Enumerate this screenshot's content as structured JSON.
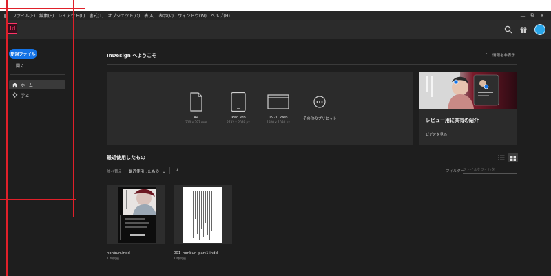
{
  "menubar": {
    "items": [
      "ファイル(F)",
      "編集(E)",
      "レイアウト(L)",
      "書式(T)",
      "オブジェクト(O)",
      "表(A)",
      "表示(V)",
      "ウィンドウ(W)",
      "ヘルプ(H)"
    ]
  },
  "window_controls": [
    "—",
    "⧉",
    "✕"
  ],
  "appbar": {
    "logo": "Id"
  },
  "sidebar": {
    "new_file": "新規ファイル",
    "open": "開く",
    "nav": [
      {
        "label": "ホーム",
        "icon": "home-icon",
        "active": true
      },
      {
        "label": "学ぶ",
        "icon": "lightbulb-icon",
        "active": false
      }
    ]
  },
  "welcome": {
    "title": "InDesign へようこそ",
    "hide_info": "情報を非表示"
  },
  "presets": [
    {
      "name": "A4",
      "size": "210 x 297 mm",
      "icon": "document-icon"
    },
    {
      "name": "iPad Pro",
      "size": "2732 x 2048 px",
      "icon": "tablet-icon"
    },
    {
      "name": "1920 Web",
      "size": "1920 x 1080 px",
      "icon": "web-icon"
    },
    {
      "name": "その他のプリセット",
      "size": "",
      "icon": "more-icon"
    }
  ],
  "promo": {
    "title": "レビュー用に共有の紹介",
    "link": "ビデオを見る"
  },
  "recent": {
    "title": "最近使用したもの",
    "sort_label": "並べ替え",
    "sort_value": "最近使用したもの",
    "sort_dir": "↓",
    "filter_label": "フィルター",
    "filter_placeholder": "ファイルをフィルター",
    "files": [
      {
        "name": "honbun.indd",
        "time": "1 時間前"
      },
      {
        "name": "001_honbun_part1.indd",
        "time": "1 時間前"
      }
    ]
  },
  "colors": {
    "accent": "#1473e6",
    "brand": "#ff3366",
    "annotation": "#e0202a"
  }
}
